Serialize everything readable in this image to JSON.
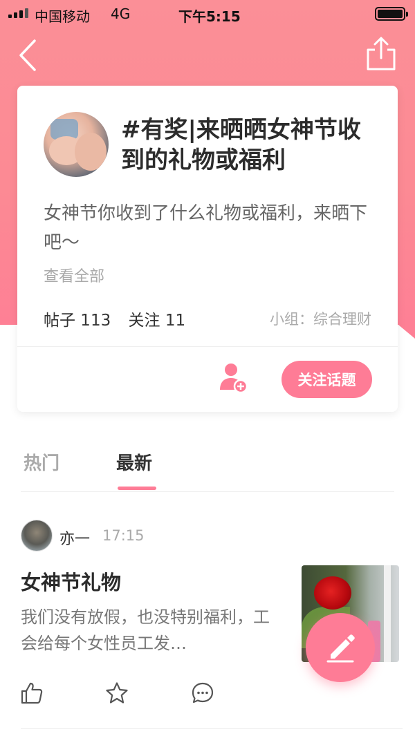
{
  "status_bar": {
    "carrier": "中国移动",
    "network": "4G",
    "time": "下午5:15"
  },
  "nav": {
    "back_icon": "chevron-left-icon",
    "share_icon": "share-icon"
  },
  "topic": {
    "title": "#有奖|来晒晒女神节收到的礼物或福利",
    "description": "女神节你收到了什么礼物或福利，来晒下吧～",
    "view_all": "查看全部",
    "posts_label": "帖子 113",
    "followers_label": "关注 11",
    "group_label": "小组：综合理财",
    "follow_button": "关注话题",
    "add_user_icon": "add-user-icon"
  },
  "tabs": [
    {
      "label": "热门",
      "active": false
    },
    {
      "label": "最新",
      "active": true
    }
  ],
  "post": {
    "author": "亦一",
    "time": "17:15",
    "title": "女神节礼物",
    "excerpt": "我们没有放假，也没特别福利，工会给每个女性员工发…",
    "actions": [
      "like-icon",
      "star-icon",
      "comment-icon"
    ]
  },
  "fab_icon": "pencil-icon",
  "colors": {
    "accent": "#fe7c96",
    "hero": "#fb8f97"
  }
}
